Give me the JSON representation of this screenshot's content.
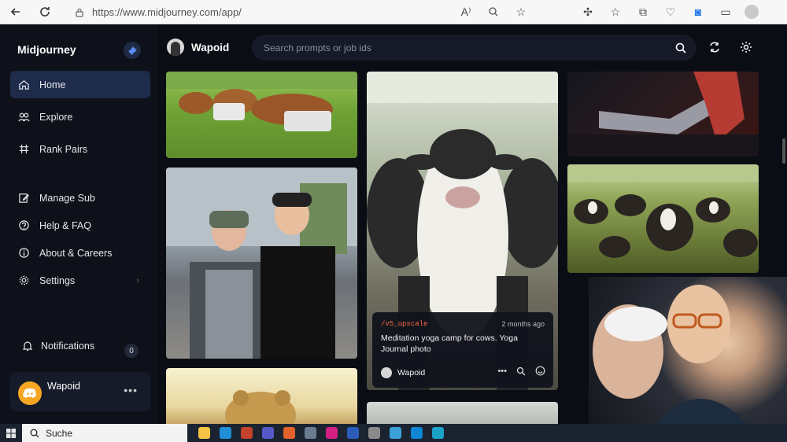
{
  "browser": {
    "url": "https://www.midjourney.com/app/"
  },
  "sidebar": {
    "brand": "Midjourney",
    "items": [
      {
        "label": "Home",
        "icon": "home-icon"
      },
      {
        "label": "Explore",
        "icon": "compass-icon"
      },
      {
        "label": "Rank Pairs",
        "icon": "rank-icon"
      },
      {
        "label": "Manage Sub",
        "icon": "edit-icon"
      },
      {
        "label": "Help & FAQ",
        "icon": "help-icon"
      },
      {
        "label": "About & Careers",
        "icon": "info-icon"
      },
      {
        "label": "Settings",
        "icon": "gear-icon"
      }
    ],
    "notifications_label": "Notifications",
    "notifications_count": "0",
    "user": {
      "name": "Wapoid"
    }
  },
  "topbar": {
    "username": "Wapoid",
    "search_placeholder": "Search prompts or job ids"
  },
  "tooltip": {
    "tag": "/v5_upscale",
    "time": "2 months ago",
    "prompt": "Meditation yoga camp for cows. Yoga Journal photo",
    "user": "Wapoid"
  },
  "taskbar": {
    "search_label": "Suche"
  },
  "colors": {
    "accent": "#1e2b4a",
    "tag": "#ff6a3d",
    "background": "#0b0d14"
  }
}
